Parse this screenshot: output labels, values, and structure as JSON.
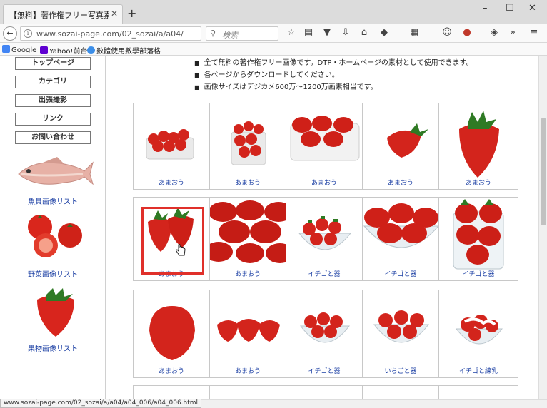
{
  "browser": {
    "tab_title": "【無料】著作権フリー写真素...",
    "tab_close": "✕",
    "new_tab": "+",
    "window_minimize": "–",
    "window_maximize": "☐",
    "window_close": "✕",
    "back": "←",
    "url": "www.sozai-page.com/02_sozai/a/a04/",
    "reload": "C",
    "search_placeholder": "検索",
    "overflow": "»",
    "menu": "≡"
  },
  "bookmarks": [
    {
      "label": "Google",
      "color": "#4285f4"
    },
    {
      "label": "Yahoo!前台",
      "color": "#5f01d1"
    },
    {
      "label": "數體使用數學部落格",
      "color": "#3b8ee8"
    }
  ],
  "sidebar": {
    "nav": [
      "トップページ",
      "カテゴリ",
      "出張撮影",
      "リンク",
      "お問い合わせ"
    ],
    "links": [
      "魚貝画像リスト",
      "野菜画像リスト",
      "果物画像リスト"
    ]
  },
  "intro_bullets": [
    "全て無料の著作権フリー画像です。DTP・ホームページの素材として使用できます。",
    "各ページからダウンロードしてください。",
    "画像サイズはデジカメ600万～1200万画素相当です。"
  ],
  "gallery_rows": [
    [
      "あまおう",
      "あまおう",
      "あまおう",
      "あまおう",
      "あまおう"
    ],
    [
      "あまおう",
      "あまおう",
      "イチゴと器",
      "イチゴと器",
      "イチゴと器"
    ],
    [
      "あまおう",
      "あまおう",
      "イチゴと器",
      "いちごと器",
      "イチゴと練乳"
    ]
  ],
  "status_url": "www.sozai-page.com/02_sozai/a/a04/a04_006/a04_006.html"
}
